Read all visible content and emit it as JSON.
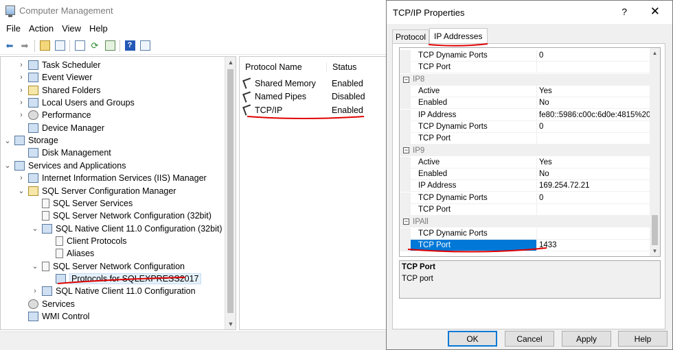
{
  "main_window": {
    "title": "Computer Management",
    "menu": [
      "File",
      "Action",
      "View",
      "Help"
    ],
    "toolbar_icons": [
      "back-arrow-icon",
      "forward-arrow-icon",
      "up-folder-icon",
      "show-hide-tree-icon",
      "properties-icon",
      "refresh-icon",
      "export-list-icon",
      "help-icon",
      "show-hide-action-pane-icon"
    ]
  },
  "tree": {
    "items": [
      {
        "label": "Task Scheduler",
        "chevron": "›"
      },
      {
        "label": "Event Viewer",
        "chevron": "›"
      },
      {
        "label": "Shared Folders",
        "chevron": "›"
      },
      {
        "label": "Local Users and Groups",
        "chevron": "›"
      },
      {
        "label": "Performance",
        "chevron": "›"
      },
      {
        "label": "Device Manager",
        "chevron": ""
      },
      {
        "label": "Storage",
        "chevron": "⌄"
      },
      {
        "label": "Disk Management",
        "chevron": ""
      },
      {
        "label": "Services and Applications",
        "chevron": "⌄"
      },
      {
        "label": "Internet Information Services (IIS) Manager",
        "chevron": "›"
      },
      {
        "label": "SQL Server Configuration Manager",
        "chevron": "⌄"
      },
      {
        "label": "SQL Server Services",
        "chevron": ""
      },
      {
        "label": "SQL Server Network Configuration (32bit)",
        "chevron": ""
      },
      {
        "label": "SQL Native Client 11.0 Configuration (32bit)",
        "chevron": "⌄"
      },
      {
        "label": "Client Protocols",
        "chevron": ""
      },
      {
        "label": "Aliases",
        "chevron": ""
      },
      {
        "label": "SQL Server Network Configuration",
        "chevron": "⌄"
      },
      {
        "label": "Protocols for SQLEXPRESS2017",
        "chevron": ""
      },
      {
        "label": "SQL Native Client 11.0 Configuration",
        "chevron": "›"
      },
      {
        "label": "Services",
        "chevron": ""
      },
      {
        "label": "WMI Control",
        "chevron": ""
      }
    ]
  },
  "protocols": {
    "headers": [
      "Protocol Name",
      "Status"
    ],
    "rows": [
      {
        "name": "Shared Memory",
        "status": "Enabled"
      },
      {
        "name": "Named Pipes",
        "status": "Disabled"
      },
      {
        "name": "TCP/IP",
        "status": "Enabled"
      }
    ]
  },
  "dialog": {
    "title": "TCP/IP Properties",
    "help_glyph": "?",
    "close_glyph": "✕",
    "tabs": [
      "Protocol",
      "IP Addresses"
    ],
    "active_tab": "IP Addresses",
    "grid_rows": [
      {
        "type": "prop",
        "name": "TCP Dynamic Ports",
        "value": "0"
      },
      {
        "type": "prop",
        "name": "TCP Port",
        "value": ""
      },
      {
        "type": "group",
        "name": "IP8"
      },
      {
        "type": "prop",
        "name": "Active",
        "value": "Yes"
      },
      {
        "type": "prop",
        "name": "Enabled",
        "value": "No"
      },
      {
        "type": "prop",
        "name": "IP Address",
        "value": "fe80::5986:c00c:6d0e:4815%20"
      },
      {
        "type": "prop",
        "name": "TCP Dynamic Ports",
        "value": "0"
      },
      {
        "type": "prop",
        "name": "TCP Port",
        "value": ""
      },
      {
        "type": "group",
        "name": "IP9"
      },
      {
        "type": "prop",
        "name": "Active",
        "value": "Yes"
      },
      {
        "type": "prop",
        "name": "Enabled",
        "value": "No"
      },
      {
        "type": "prop",
        "name": "IP Address",
        "value": "169.254.72.21"
      },
      {
        "type": "prop",
        "name": "TCP Dynamic Ports",
        "value": "0"
      },
      {
        "type": "prop",
        "name": "TCP Port",
        "value": ""
      },
      {
        "type": "group",
        "name": "IPAll"
      },
      {
        "type": "prop",
        "name": "TCP Dynamic Ports",
        "value": ""
      },
      {
        "type": "prop",
        "name": "TCP Port",
        "value": "1433",
        "selected": true
      }
    ],
    "description": {
      "title": "TCP Port",
      "text": "TCP port"
    },
    "buttons": {
      "ok": "OK",
      "cancel": "Cancel",
      "apply": "Apply",
      "help": "Help"
    }
  },
  "colors": {
    "selection": "#0078d7",
    "annotation": "#e00000"
  }
}
